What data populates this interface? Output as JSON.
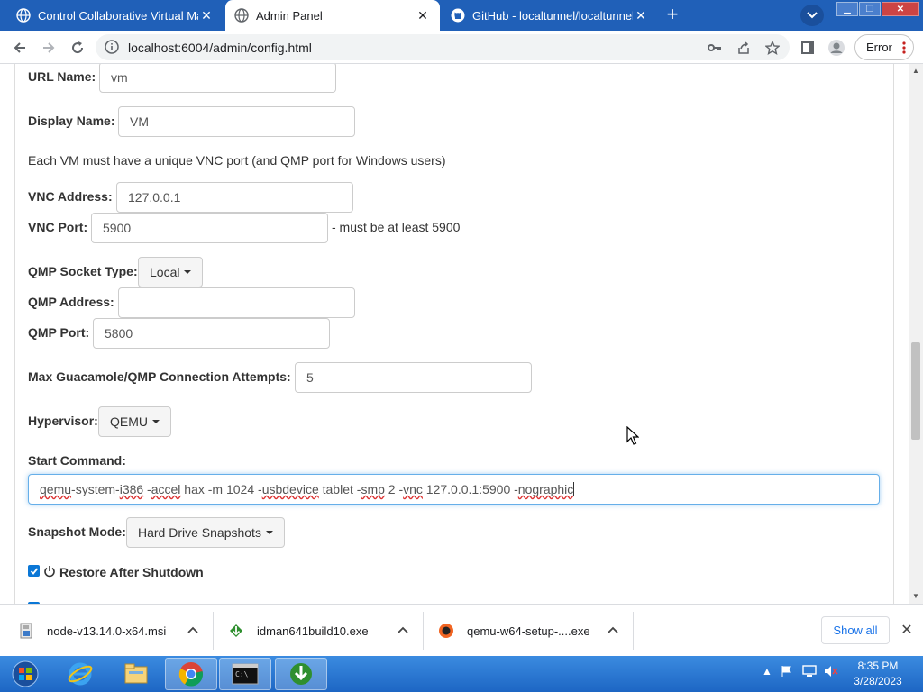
{
  "browser": {
    "tabs": [
      {
        "title": "Control Collaborative Virtual Ma",
        "icon": "globe-icon"
      },
      {
        "title": "Admin Panel",
        "icon": "globe-icon",
        "active": true
      },
      {
        "title": "GitHub - localtunnel/localtunnel",
        "icon": "github-icon"
      }
    ],
    "new_tab_label": "+",
    "url": "localhost:6004/admin/config.html",
    "error_label": "Error"
  },
  "form": {
    "url_name_label": "URL Name:",
    "url_name_value": "vm",
    "display_name_label": "Display Name:",
    "display_name_value": "VM",
    "vnc_note": "Each VM must have a unique VNC port (and QMP port for Windows users)",
    "vnc_address_label": "VNC Address:",
    "vnc_address_value": "127.0.0.1",
    "vnc_port_label": "VNC Port:",
    "vnc_port_value": "5900",
    "vnc_port_hint": "- must be at least 5900",
    "qmp_socket_type_label": "QMP Socket Type:",
    "qmp_socket_type_value": "Local",
    "qmp_address_label": "QMP Address:",
    "qmp_address_value": "",
    "qmp_port_label": "QMP Port:",
    "qmp_port_value": "5800",
    "max_attempts_label": "Max Guacamole/QMP Connection Attempts:",
    "max_attempts_value": "5",
    "hypervisor_label": "Hypervisor:",
    "hypervisor_value": "QEMU",
    "start_command_label": "Start Command:",
    "start_command_value": "qemu-system-i386 -accel hax -m 1024 -usbdevice tablet -smp 2 -vnc 127.0.0.1:5900 -nographic",
    "start_command_parts": {
      "p1": "qemu",
      "p2": "-system-",
      "p3": "i386",
      "p4": " -",
      "p5": "accel",
      "p6": " hax -m 1024 -",
      "p7": "usbdevice",
      "p8": " tablet -",
      "p9": "smp",
      "p10": " 2 -",
      "p11": "vnc",
      "p12": " 127.0.0.1:5900 -",
      "p13": "nographic"
    },
    "snapshot_mode_label": "Snapshot Mode:",
    "snapshot_mode_value": "Hard Drive Snapshots",
    "restore_after_shutdown_label": "Restore After Shutdown",
    "restore_after_shutdown_checked": true
  },
  "downloads": [
    {
      "name": "node-v13.14.0-x64.msi",
      "icon": "installer-icon"
    },
    {
      "name": "idman641build10.exe",
      "icon": "idm-icon"
    },
    {
      "name": "qemu-w64-setup-....exe",
      "icon": "qemu-icon"
    }
  ],
  "show_all_label": "Show all",
  "taskbar": {
    "apps": [
      "internet-explorer-icon",
      "file-explorer-icon",
      "chrome-icon",
      "cmd-icon",
      "idm-icon"
    ],
    "time": "8:35 PM",
    "date": "3/28/2023"
  },
  "colors": {
    "titlebar": "#2060b8",
    "focus_border": "#66afe9",
    "checkbox": "#0b77d6",
    "taskbar": "#1d66c4"
  }
}
